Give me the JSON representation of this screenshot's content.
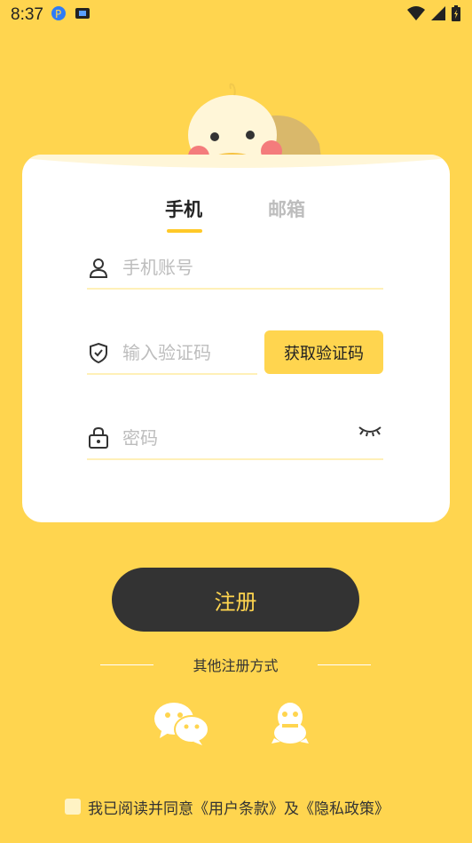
{
  "status_bar": {
    "time": "8:37"
  },
  "tabs": {
    "phone": "手机",
    "email": "邮箱"
  },
  "form": {
    "phone_placeholder": "手机账号",
    "code_placeholder": "输入验证码",
    "get_code_label": "获取验证码",
    "password_placeholder": "密码"
  },
  "register_label": "注册",
  "other_methods_label": "其他注册方式",
  "agreement_text": "我已阅读并同意《用户条款》及《隐私政策》",
  "colors": {
    "background": "#FFD54F",
    "accent": "#FFC928",
    "button_dark": "#333333"
  },
  "icons": [
    "user-icon",
    "shield-check-icon",
    "lock-icon",
    "eye-closed-icon",
    "wechat-icon",
    "qq-icon"
  ]
}
